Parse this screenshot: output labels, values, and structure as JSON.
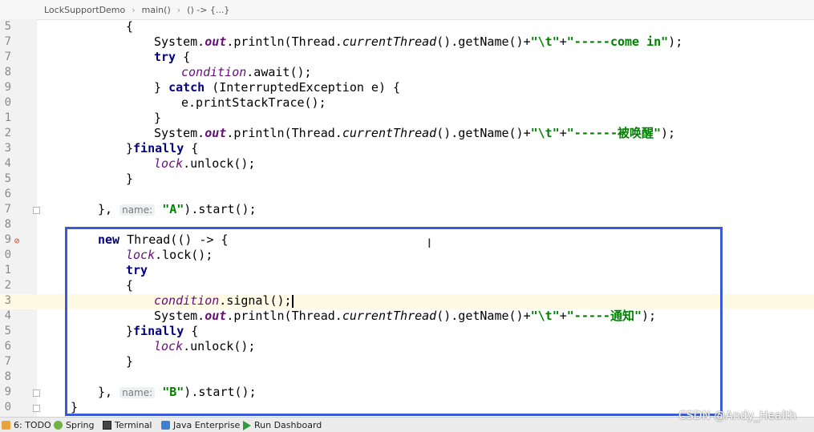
{
  "breadcrumb": [
    "LockSupportDemo",
    "main()",
    "() -> {...}"
  ],
  "line_numbers": [
    "5",
    "7",
    "7",
    "8",
    "9",
    "0",
    "1",
    "2",
    "3",
    "4",
    "5",
    "6",
    "7",
    "8",
    "9",
    "0",
    "1",
    "2",
    "3",
    "4",
    "5",
    "6",
    "7",
    "8",
    "9",
    "0"
  ],
  "code": {
    "l1": {
      "open": "{"
    },
    "l2": {
      "a": "System.",
      "b": "out",
      "c": ".println(Thread.",
      "d": "currentThread",
      "e": "().getName()+",
      "f": "\"\\t\"",
      "g": "+",
      "h": "\"-----come in\"",
      "i": ");"
    },
    "l3": {
      "kw": "try",
      "rest": " {"
    },
    "l4": {
      "fld": "condition",
      "rest": ".await();"
    },
    "l5": {
      "a": "} ",
      "kw": "catch",
      "rest": " (InterruptedException e) {"
    },
    "l6": {
      "text": "e.printStackTrace();"
    },
    "l7": {
      "text": "}"
    },
    "l8": {
      "a": "System.",
      "b": "out",
      "c": ".println(Thread.",
      "d": "currentThread",
      "e": "().getName()+",
      "f": "\"\\t\"",
      "g": "+",
      "h": "\"------被唤醒\"",
      "i": ");"
    },
    "l9": {
      "a": "}",
      "kw": "finally",
      "rest": " {"
    },
    "l10": {
      "fld": "lock",
      "rest": ".unlock();"
    },
    "l11": {
      "text": "}"
    },
    "l12": {
      "a": "}, ",
      "hint": "name:",
      "sp": " ",
      "str": "\"A\"",
      "rest": ").start();"
    },
    "l13": {
      "kw": "new",
      "rest": " Thread(() -> {"
    },
    "l14": {
      "fld": "lock",
      "rest": ".lock();"
    },
    "l15": {
      "kw": "try"
    },
    "l16": {
      "text": "{"
    },
    "l17": {
      "fld": "condition",
      "rest": ".signal();"
    },
    "l18": {
      "a": "System.",
      "b": "out",
      "c": ".println(Thread.",
      "d": "currentThread",
      "e": "().getName()+",
      "f": "\"\\t\"",
      "g": "+",
      "h": "\"-----通知\"",
      "i": ");"
    },
    "l19": {
      "a": "}",
      "kw": "finally",
      "rest": " {"
    },
    "l20": {
      "fld": "lock",
      "rest": ".unlock();"
    },
    "l21": {
      "text": "}"
    },
    "l22": {
      "a": "}, ",
      "hint": "name:",
      "sp": " ",
      "str": "\"B\"",
      "rest": ").start();"
    },
    "l23": {
      "text": "}"
    }
  },
  "statusbar": {
    "todo": "6: TODO",
    "spring": "Spring",
    "terminal": "Terminal",
    "java_enterprise": "Java Enterprise",
    "run_dashboard": "Run Dashboard"
  },
  "watermark": "CSDN @Andy_Health",
  "colors": {
    "keyword": "#000080",
    "string": "#008000",
    "field": "#660e7a",
    "selection_box": "#3a5bd6",
    "current_line": "#fffae3"
  }
}
